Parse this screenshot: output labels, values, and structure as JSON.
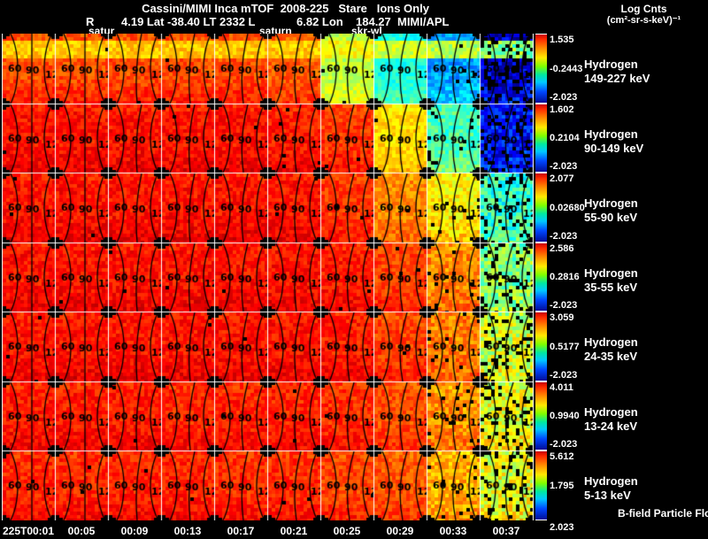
{
  "header": {
    "title": "Cassini/MIMI Inca mTOF  2008-225   Stare   Ions Only",
    "colorbar_title": "Log Cnts",
    "colorbar_units": "(cm²-sr-s-keV)⁻¹",
    "ephemeris": [
      "R",
      "4.19 Lat -38.40 LT 2332 L",
      "6.82 Lon",
      "184.27  MIMI/APL"
    ]
  },
  "overlay_markers": [
    "satur",
    "saturn",
    "skr-wl"
  ],
  "chart_data": {
    "type": "heatmap",
    "title": "Cassini/MIMI Inca mTOF  2008-225   Stare   Ions Only",
    "colormap": "jet",
    "x_axis": {
      "tick_labels": [
        "225T00:01",
        "00:05",
        "00:09",
        "00:13",
        "00:17",
        "00:21",
        "00:25",
        "00:29",
        "00:33",
        "00:37"
      ]
    },
    "contour_tick_labels": [
      "60",
      "90",
      "12"
    ],
    "rows": [
      {
        "species": "Hydrogen",
        "energy_range": "149-227 keV",
        "cbar_top": "1.535",
        "cbar_mid": "-0.2443",
        "cbar_bot": "-2.023",
        "levels": [
          0.8,
          0.8,
          0.8,
          0.8,
          0.8,
          0.78,
          0.56,
          0.4,
          0.28,
          0.08
        ]
      },
      {
        "species": "Hydrogen",
        "energy_range": "90-149 keV",
        "cbar_top": "1.602",
        "cbar_mid": "0.2104",
        "cbar_bot": "-2.023",
        "levels": [
          0.86,
          0.86,
          0.86,
          0.86,
          0.86,
          0.85,
          0.82,
          0.66,
          0.45,
          0.13
        ]
      },
      {
        "species": "Hydrogen",
        "energy_range": "55-90 keV",
        "cbar_top": "2.077",
        "cbar_mid": "0.02680",
        "cbar_bot": "-2.023",
        "levels": [
          0.86,
          0.86,
          0.86,
          0.86,
          0.86,
          0.86,
          0.82,
          0.74,
          0.64,
          0.42
        ]
      },
      {
        "species": "Hydrogen",
        "energy_range": "35-55 keV",
        "cbar_top": "2.586",
        "cbar_mid": "0.2816",
        "cbar_bot": "-2.023",
        "levels": [
          0.86,
          0.86,
          0.86,
          0.86,
          0.86,
          0.86,
          0.85,
          0.81,
          0.74,
          0.5
        ]
      },
      {
        "species": "Hydrogen",
        "energy_range": "24-35 keV",
        "cbar_top": "3.059",
        "cbar_mid": "0.5177",
        "cbar_bot": "-2.023",
        "levels": [
          0.86,
          0.86,
          0.86,
          0.86,
          0.86,
          0.86,
          0.85,
          0.81,
          0.75,
          0.58
        ]
      },
      {
        "species": "Hydrogen",
        "energy_range": "13-24 keV",
        "cbar_top": "4.011",
        "cbar_mid": "0.9940",
        "cbar_bot": "-2.023",
        "levels": [
          0.85,
          0.85,
          0.85,
          0.84,
          0.84,
          0.84,
          0.83,
          0.8,
          0.73,
          0.6
        ]
      },
      {
        "species": "Hydrogen",
        "energy_range": "5-13 keV",
        "cbar_top": "5.612",
        "cbar_mid": "1.795",
        "cbar_bot": "2.023",
        "levels": [
          0.84,
          0.84,
          0.84,
          0.84,
          0.83,
          0.83,
          0.81,
          0.79,
          0.7,
          0.6
        ]
      }
    ],
    "footer_note": "B-field Particle Flow"
  }
}
